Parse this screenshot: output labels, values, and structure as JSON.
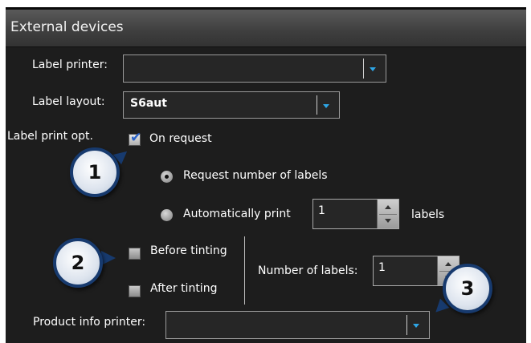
{
  "header": {
    "title": "External devices"
  },
  "label_printer": {
    "label": "Label printer:",
    "value": ""
  },
  "label_layout": {
    "label": "Label layout:",
    "value": "S6aut"
  },
  "label_print_opt": {
    "label": "Label print opt.",
    "on_request": {
      "label": "On request",
      "checked": true
    },
    "request_number": {
      "label": "Request number of labels",
      "selected": true
    },
    "auto_print": {
      "label": "Automatically print",
      "value": "1",
      "unit": "labels",
      "selected": false
    }
  },
  "tinting": {
    "before": {
      "label": "Before tinting",
      "checked": false
    },
    "after": {
      "label": "After tinting",
      "checked": false
    },
    "number_of_labels": {
      "label": "Number of labels:",
      "value": "1"
    }
  },
  "product_info_printer": {
    "label": "Product info printer:",
    "value": ""
  },
  "callouts": [
    "1",
    "2",
    "3"
  ],
  "colors": {
    "accent_arrow": "#2ea6e6",
    "callout_border": "#173a6e",
    "panel_bg": "#1d1d1d"
  }
}
